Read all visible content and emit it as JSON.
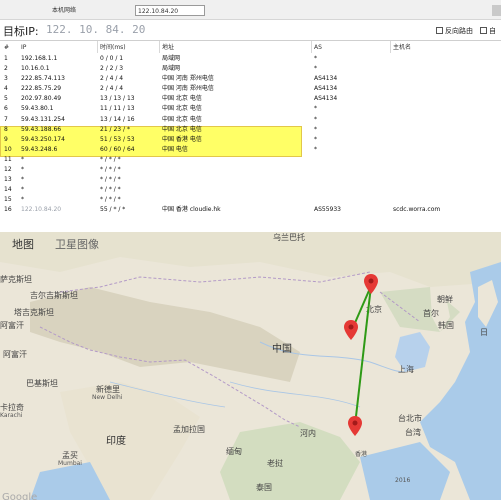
{
  "window": {
    "tab1": "本机网络",
    "tab2": "122.10.84.20"
  },
  "target": {
    "label": "目标IP:",
    "ip": "122. 10. 84. 20",
    "options": [
      "反向路由",
      "自"
    ]
  },
  "table": {
    "headers": [
      "#",
      "IP",
      "时间(ms)",
      "地址",
      "AS",
      "主机名"
    ],
    "rows": [
      {
        "no": "1",
        "ip": "192.168.1.1",
        "time": "0 / 0 / 1",
        "loc": "局域网",
        "as": "*",
        "host": ""
      },
      {
        "no": "2",
        "ip": "10.16.0.1",
        "time": "2 / 2 / 3",
        "loc": "局域网",
        "as": "*",
        "host": ""
      },
      {
        "no": "3",
        "ip": "222.85.74.113",
        "time": "2 / 4 / 4",
        "loc": "中国 河南 郑州电信",
        "as": "AS4134",
        "host": ""
      },
      {
        "no": "4",
        "ip": "222.85.75.29",
        "time": "2 / 4 / 4",
        "loc": "中国 河南 郑州电信",
        "as": "AS4134",
        "host": ""
      },
      {
        "no": "5",
        "ip": "202.97.80.49",
        "time": "13 / 13 / 13",
        "loc": "中国 北京 电信",
        "as": "AS4134",
        "host": ""
      },
      {
        "no": "6",
        "ip": "59.43.80.1",
        "time": "11 / 11 / 13",
        "loc": "中国 北京 电信",
        "as": "*",
        "host": ""
      },
      {
        "no": "7",
        "ip": "59.43.131.254",
        "time": "13 / 14 / 16",
        "loc": "中国 北京 电信",
        "as": "*",
        "host": ""
      },
      {
        "no": "8",
        "ip": "59.43.188.66",
        "time": "21 / 23 / *",
        "loc": "中国 北京 电信",
        "as": "*",
        "host": ""
      },
      {
        "no": "9",
        "ip": "59.43.250.174",
        "time": "51 / 53 / 53",
        "loc": "中国 香港 电信",
        "as": "*",
        "host": ""
      },
      {
        "no": "10",
        "ip": "59.43.248.6",
        "time": "60 / 60 / 64",
        "loc": "中国 电信",
        "as": "*",
        "host": ""
      },
      {
        "no": "11",
        "ip": "*",
        "time": "* / * / *",
        "loc": "",
        "as": "",
        "host": ""
      },
      {
        "no": "12",
        "ip": "*",
        "time": "* / * / *",
        "loc": "",
        "as": "",
        "host": ""
      },
      {
        "no": "13",
        "ip": "*",
        "time": "* / * / *",
        "loc": "",
        "as": "",
        "host": ""
      },
      {
        "no": "14",
        "ip": "*",
        "time": "* / * / *",
        "loc": "",
        "as": "",
        "host": ""
      },
      {
        "no": "15",
        "ip": "*",
        "time": "* / * / *",
        "loc": "",
        "as": "",
        "host": ""
      },
      {
        "no": "16",
        "ip": "122.10.84.20",
        "time": "55 / * / *",
        "loc": "中国 香港 cloudie.hk",
        "as": "AS55933",
        "host": "scdc.worra.com"
      }
    ]
  },
  "map": {
    "tabs": [
      "地图",
      "卫星图像"
    ],
    "labels": {
      "karachi": "卡拉奇",
      "karachi_en": "Karachi",
      "kazakh": "萨克斯坦",
      "ulaanbaatar": "乌兰巴托",
      "kyrgyz": "吉尔吉斯斯坦",
      "tajik": "塔吉克斯坦",
      "afghan": "阿富汗",
      "pakistan": "巴基斯坦",
      "newdelhi": "新德里",
      "newdelhi_en": "New Delhi",
      "india": "印度",
      "mumbai": "孟买",
      "mumbai_en": "Mumbai",
      "bangladesh": "孟加拉国",
      "myanmar": "缅甸",
      "thailand": "泰国",
      "laos": "老挝",
      "china": "中国",
      "nkorea": "朝鲜",
      "skorea": "韩国",
      "seoul": "首尔",
      "shanghai": "上海",
      "taipei": "台北市",
      "taiwan": "台湾",
      "hongkong": "香港",
      "hanoi": "河内",
      "beijing": "北京",
      "japan": "日",
      "scale": "2016"
    },
    "route_color": "#2e9a16",
    "pin_color": "#e53935",
    "footer": "Google"
  }
}
